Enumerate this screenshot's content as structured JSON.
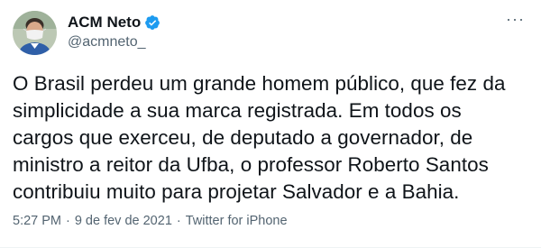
{
  "author": {
    "display_name": "ACM Neto",
    "handle": "@acmneto_",
    "verified": true,
    "verified_color": "#1d9bf0"
  },
  "tweet": {
    "text_lines": [
      "O Brasil perdeu um grande homem público, que fez da",
      "simplicidade a sua marca registrada. Em todos os",
      "cargos que exerceu, de deputado a governador, de",
      "ministro a reitor da Ufba, o professor Roberto Santos",
      "contribuiu muito para projetar Salvador e a Bahia."
    ],
    "time": "5:27 PM",
    "separator": "·",
    "date": "9 de fev de 2021",
    "source": "Twitter for iPhone"
  },
  "menu": {
    "more_label": "···"
  }
}
